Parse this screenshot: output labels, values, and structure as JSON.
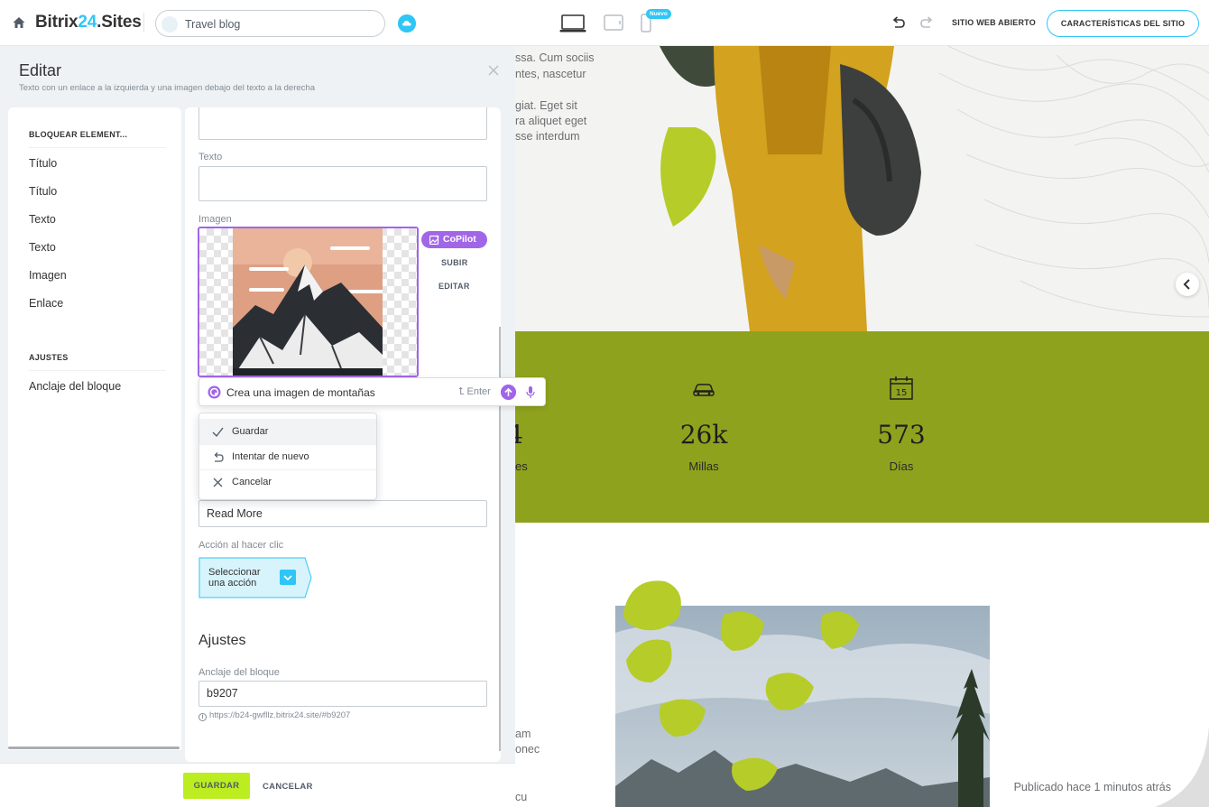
{
  "topbar": {
    "brand_prefix": "Bitrix",
    "brand_number": "24",
    "brand_suffix": ".Sites",
    "site_name": "Travel blog",
    "new_badge": "Nuevo",
    "open_site": "SITIO WEB ABIERTO",
    "site_features": "CARACTERÍSTICAS DEL SITIO"
  },
  "editor": {
    "title": "Editar",
    "subtitle": "Texto con un enlace a la izquierda y una imagen debajo del texto a la derecha",
    "nav": {
      "block_elements_head": "BLOQUEAR ELEMENT...",
      "items": [
        "Título",
        "Título",
        "Texto",
        "Texto",
        "Imagen",
        "Enlace"
      ],
      "settings_head": "AJUSTES",
      "settings_items": [
        "Anclaje del bloque"
      ]
    },
    "form": {
      "text_label": "Texto",
      "text_value": "",
      "image_label": "Imagen",
      "copilot_label": "CoPilot",
      "upload_label": "SUBIR",
      "edit_label": "EDITAR",
      "link_text_value": "Read More",
      "click_action_label": "Acción al hacer clic",
      "action_select_value": "Seleccionar una acción",
      "settings_title": "Ajustes",
      "anchor_label": "Anclaje del bloque",
      "anchor_value": "b9207",
      "anchor_hint": "https://b24-gwfllz.bitrix24.site/#b9207"
    },
    "copilot_prompt": {
      "text": "Crea una imagen de montañas",
      "enter_hint": "Enter"
    },
    "copilot_menu": [
      "Guardar",
      "Intentar de nuevo",
      "Cancelar"
    ],
    "footer": {
      "save": "GUARDAR",
      "cancel": "CANCELAR"
    }
  },
  "preview": {
    "text_lines": [
      "ssa. Cum sociis",
      "ntes, nascetur",
      "giat. Eget sit",
      "ra aliquet eget",
      "sse interdum"
    ],
    "stats": [
      {
        "value": "4",
        "label": "es",
        "icon": "stat-icon-partial"
      },
      {
        "value": "26k",
        "label": "Millas",
        "icon": "car-icon"
      },
      {
        "value": "573",
        "label": "Días",
        "icon": "calendar-icon"
      }
    ],
    "calendar_number": "15",
    "bottom_text": [
      "am",
      "onec",
      "cu"
    ],
    "published": "Publicado hace 1 minutos atrás",
    "colors": {
      "green_band": "#8fa21d",
      "accent_lime": "#bbed21",
      "copilot_purple": "#a166e8",
      "brand_blue": "#2fc6f6"
    }
  }
}
